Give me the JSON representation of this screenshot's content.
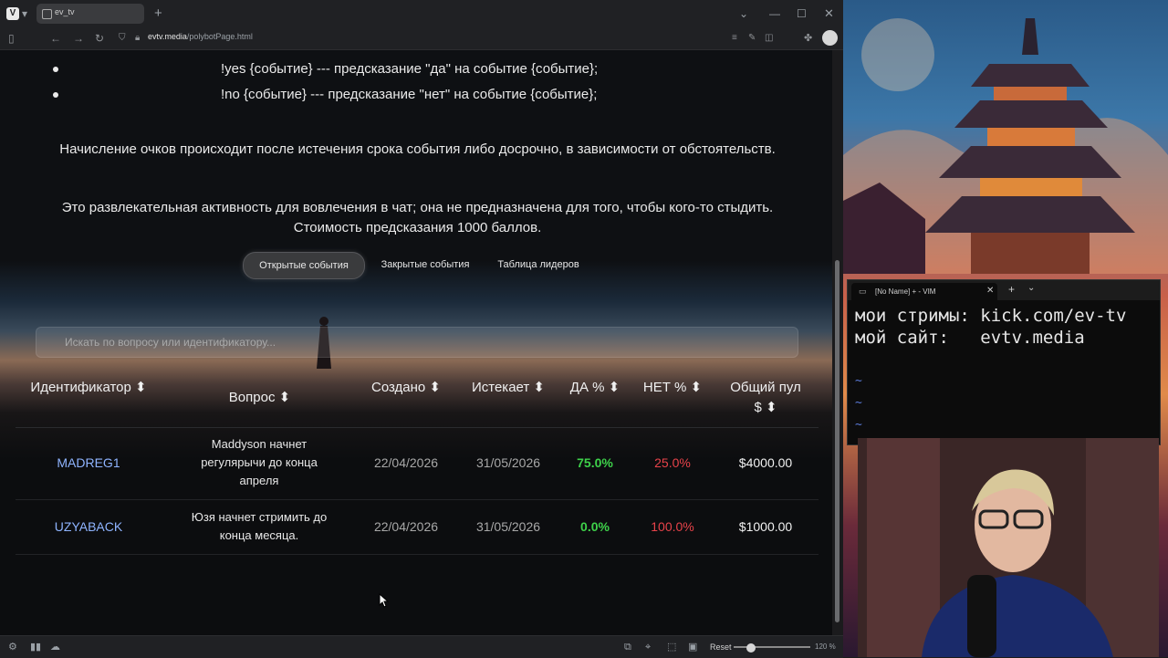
{
  "browser": {
    "tab_title": "ev_tv",
    "address_host": "evtv.media",
    "address_path": "/polybotPage.html",
    "zoom_reset_label": "Reset",
    "zoom_level": "120 %"
  },
  "page": {
    "commands": [
      "!yes {событие} --- предсказание \"да\" на событие {событие};",
      "!no {событие} --- предсказание \"нет\" на событие {событие};"
    ],
    "para1": "Начисление очков происходит после истечения срока события либо досрочно, в зависимости от обстоятельств.",
    "para2": "Это развлекательная активность для вовлечения в чат; она не предназначена для того, чтобы кого-то стыдить. Стоимость предсказания 1000 баллов.",
    "tabs": {
      "open": "Открытые события",
      "closed": "Закрытые события",
      "leaders": "Таблица лидеров"
    },
    "search_placeholder": "Искать по вопросу или идентификатору...",
    "table": {
      "headers": {
        "id": "Идентификатор ⬍",
        "question": "Вопрос ⬍",
        "created": "Создано ⬍",
        "expires": "Истекает ⬍",
        "yes": "ДА % ⬍",
        "no": "НЕТ % ⬍",
        "pool": "Общий пул $ ⬍"
      },
      "rows": [
        {
          "id": "MADREG1",
          "question": "Maddyson начнет регулярычи до конца апреля",
          "created": "22/04/2026",
          "expires": "31/05/2026",
          "yes": "75.0%",
          "no": "25.0%",
          "pool": "$4000.00"
        },
        {
          "id": "UZYABACK",
          "question": "Юзя начнет стримить до конца месяца.",
          "created": "22/04/2026",
          "expires": "31/05/2026",
          "yes": "0.0%",
          "no": "100.0%",
          "pool": "$1000.00"
        }
      ]
    }
  },
  "vim": {
    "tab_title": "[No Name] + - VIM",
    "line1": "мои стримы: kick.com/ev-tv",
    "line2": "мой сайт:   evtv.media",
    "tilde": "~"
  },
  "colors": {
    "yes": "#3ed14a",
    "no": "#e8434a",
    "id_link": "#8fb4ff"
  }
}
